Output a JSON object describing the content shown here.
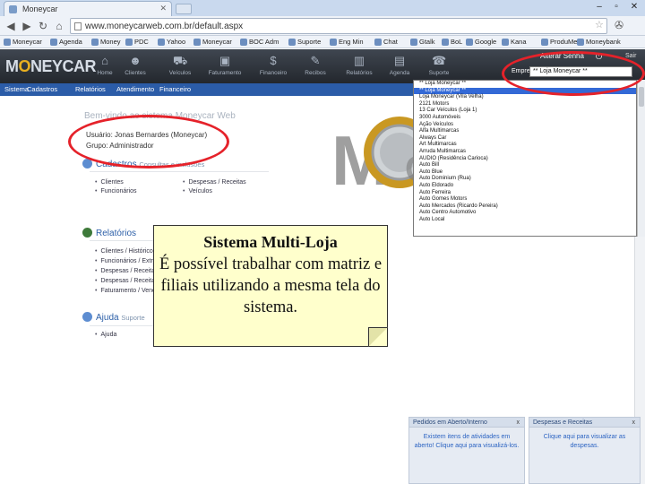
{
  "browser": {
    "tab_title": "Moneycar",
    "url": "www.moneycarweb.com.br/default.aspx",
    "bookmarks": [
      "Moneycar",
      "Agenda",
      "Money",
      "PDC",
      "Yahoo",
      "Moneycar",
      "BOC Adm",
      "Suporte",
      "Eng Min",
      "Chat",
      "Gtalk",
      "BoL",
      "Google",
      "Kana",
      "ProduMe",
      "Moneybank"
    ]
  },
  "header": {
    "logo_part1": "M",
    "logo_coin": "O",
    "logo_part2": "NEYCAR",
    "icons": [
      {
        "label": "Home",
        "icon": "home-icon",
        "glyph": "⌂"
      },
      {
        "label": "Clientes",
        "icon": "clients-icon",
        "glyph": "☻"
      },
      {
        "label": "Veículos",
        "icon": "car-icon",
        "glyph": "⛟"
      },
      {
        "label": "Faturamento",
        "icon": "billing-icon",
        "glyph": "▣"
      },
      {
        "label": "Financeiro",
        "icon": "money-icon",
        "glyph": "$"
      },
      {
        "label": "Recibos",
        "icon": "receipt-icon",
        "glyph": "✎"
      },
      {
        "label": "Relatórios",
        "icon": "reports-icon",
        "glyph": "▥"
      },
      {
        "label": "Agenda",
        "icon": "agenda-icon",
        "glyph": "▤"
      },
      {
        "label": "Suporte",
        "icon": "support-icon",
        "glyph": "☎"
      }
    ],
    "user": "Alterar Senha",
    "logout": "Sair",
    "empresa_label": "Empresa:",
    "empresa_value": "** Loja Moneycar **"
  },
  "menu": [
    "Sistema",
    "Cadastros",
    "Relatórios",
    "Atendimento",
    "Financeiro"
  ],
  "welcome": "Bem-vindo ao sistema Moneycar Web",
  "user_info": {
    "usuario": "Usuário: Jonas Bernardes (Moneycar)",
    "grupo": "Grupo: Administrador"
  },
  "cadastros": {
    "title": "Cadastros",
    "subtitle": "Consultas e inclusões",
    "col1": [
      "Clientes",
      "Funcionários"
    ],
    "col2": [
      "Despesas / Receitas",
      "Veículos"
    ]
  },
  "relatorios": {
    "title": "Relatórios",
    "items": [
      "Clientes / Histórico",
      "Funcionários / Extrato",
      "Despesas / Receitas",
      "Despesas / Receitas",
      "Faturamento / Vendas"
    ]
  },
  "ajuda": {
    "title": "Ajuda",
    "subtitle": "Suporte",
    "items": [
      "Ajuda"
    ]
  },
  "dropdown_items": [
    "** Loja Moneycar **",
    "** Loja Moneycar **",
    "Loja Moneycar (Vila Velha)",
    "2121 Motors",
    "13 Car Veículos (Loja 1)",
    "3000 Automóveis",
    "Ação Veículos",
    "Alfa Multimarcas",
    "Always Car",
    "Art Multimarcas",
    "Arruda Multimarcas",
    "AUDIO (Residência Carioca)",
    "Auto Bill",
    "Auto Blue",
    "Auto Dominium (Rua)",
    "Auto Eldorado",
    "Auto Ferreira",
    "Auto Gomes Motors",
    "Auto Mercados (Ricardo Pereira)",
    "Auto Centro Automotivo",
    "Auto Local"
  ],
  "callout": {
    "title": "Sistema Multi-Loja",
    "body": "É possível trabalhar com matriz e filiais utilizando a mesma tela do sistema."
  },
  "widgets": [
    {
      "title": "Pedidos em Aberto/Interno",
      "body": "Existem itens de atividades em aberto! Clique aqui para visualizá-los."
    },
    {
      "title": "Despesas e Receitas",
      "body": "Clique aqui para visualizar as despesas."
    }
  ],
  "colors": {
    "annotation": "#e5222a",
    "menubar": "#2b5ca8",
    "callout": "#ffffcc"
  }
}
